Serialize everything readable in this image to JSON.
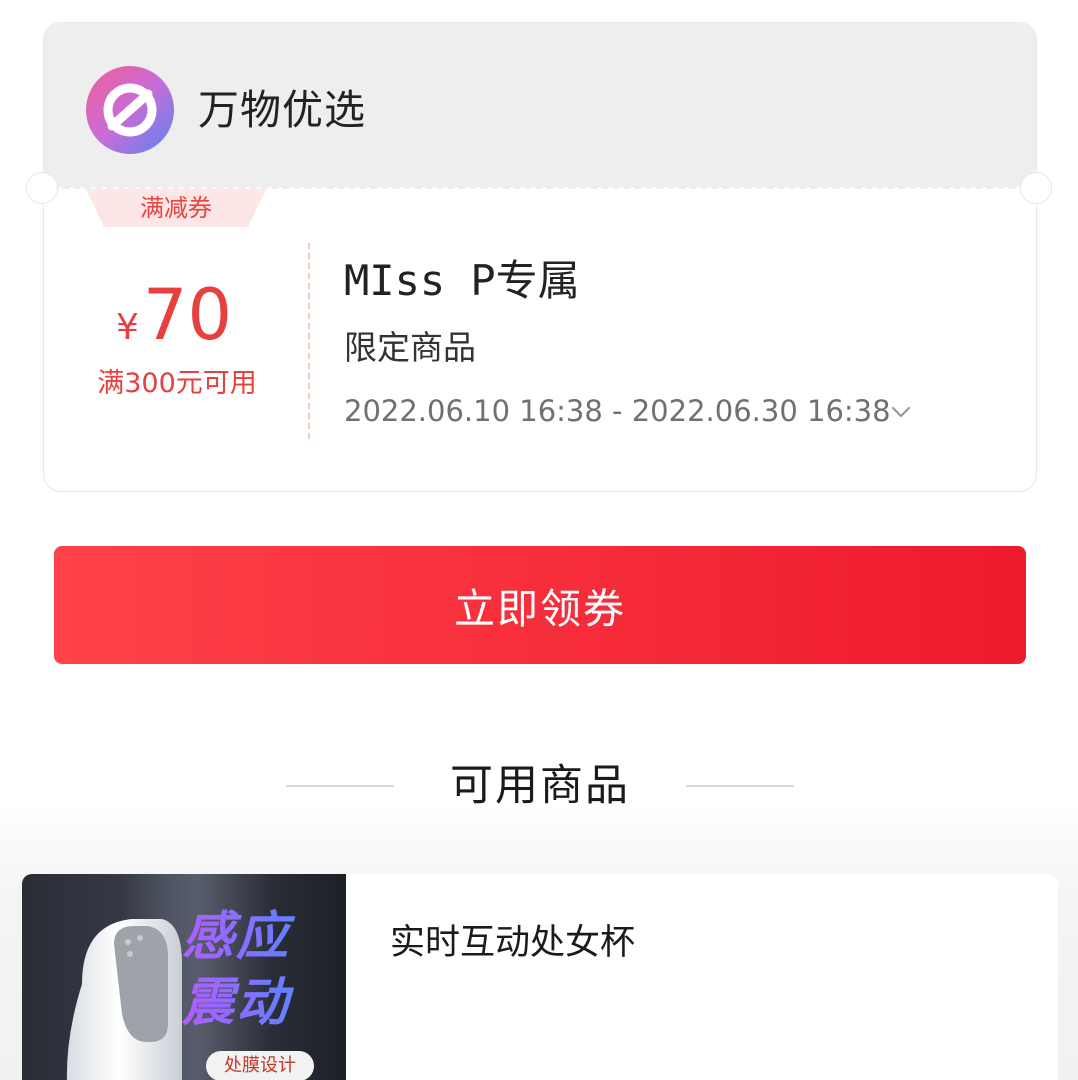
{
  "store": {
    "name": "万物优选",
    "logo_icon": "brand-logo-icon"
  },
  "coupon": {
    "type_label": "满减券",
    "currency": "¥",
    "amount": "70",
    "condition": "满300元可用",
    "title": "MIss P专属",
    "scope": "限定商品",
    "validity": "2022.06.10 16:38 - 2022.06.30 16:38",
    "expand_icon": "chevron-down-icon",
    "accent_color": "#e8403e"
  },
  "claim_button": {
    "label": "立即领券",
    "color": "#ee1a2e"
  },
  "section": {
    "title": "可用商品"
  },
  "products": [
    {
      "name": "实时互动处女杯",
      "image_headline": "感应震动",
      "image_tag": "处膜设计"
    }
  ]
}
